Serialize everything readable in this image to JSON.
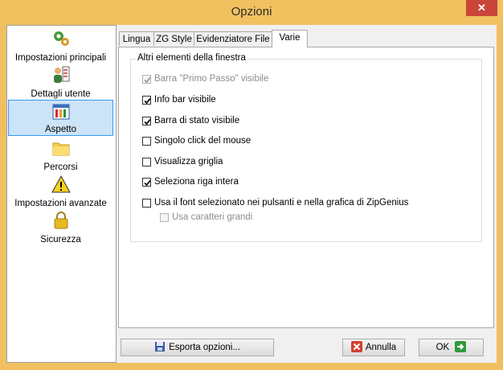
{
  "window": {
    "title": "Opzioni",
    "close_glyph": "✕"
  },
  "sidebar": {
    "items": [
      {
        "label": "Impostazioni principali",
        "icon": "gears-icon"
      },
      {
        "label": "Dettagli utente",
        "icon": "user-checklist-icon"
      },
      {
        "label": "Aspetto",
        "icon": "appearance-palette-icon",
        "selected": true
      },
      {
        "label": "Percorsi",
        "icon": "folder-icon"
      },
      {
        "label": "Impostazioni avanzate",
        "icon": "warning-icon"
      },
      {
        "label": "Sicurezza",
        "icon": "padlock-icon"
      }
    ]
  },
  "tabs": [
    {
      "label": "Lingua"
    },
    {
      "label": "ZG Style"
    },
    {
      "label": "Evidenziatore File"
    },
    {
      "label": "Varie",
      "active": true
    }
  ],
  "group": {
    "title": "Altri elementi della finestra",
    "options": [
      {
        "label": "Barra \"Primo Passo\" visibile",
        "checked": true,
        "disabled": true
      },
      {
        "label": "Info bar visibile",
        "checked": true,
        "disabled": false
      },
      {
        "label": "Barra di stato visibile",
        "checked": true,
        "disabled": false
      },
      {
        "label": "Singolo click del mouse",
        "checked": false,
        "disabled": false
      },
      {
        "label": "Visualizza griglia",
        "checked": false,
        "disabled": false
      },
      {
        "label": "Seleziona riga intera",
        "checked": true,
        "disabled": false
      },
      {
        "label": "Usa il font selezionato nei pulsanti e nella grafica di ZipGenius",
        "checked": false,
        "disabled": false
      },
      {
        "label": "Usa caratteri grandi",
        "checked": false,
        "disabled": true
      }
    ]
  },
  "buttons": {
    "export": "Esporta opzioni...",
    "cancel": "Annulla",
    "ok": "OK"
  },
  "colors": {
    "title_bar": "#f2c15f",
    "close_button": "#c9453a",
    "selection": "#cce4f7"
  }
}
